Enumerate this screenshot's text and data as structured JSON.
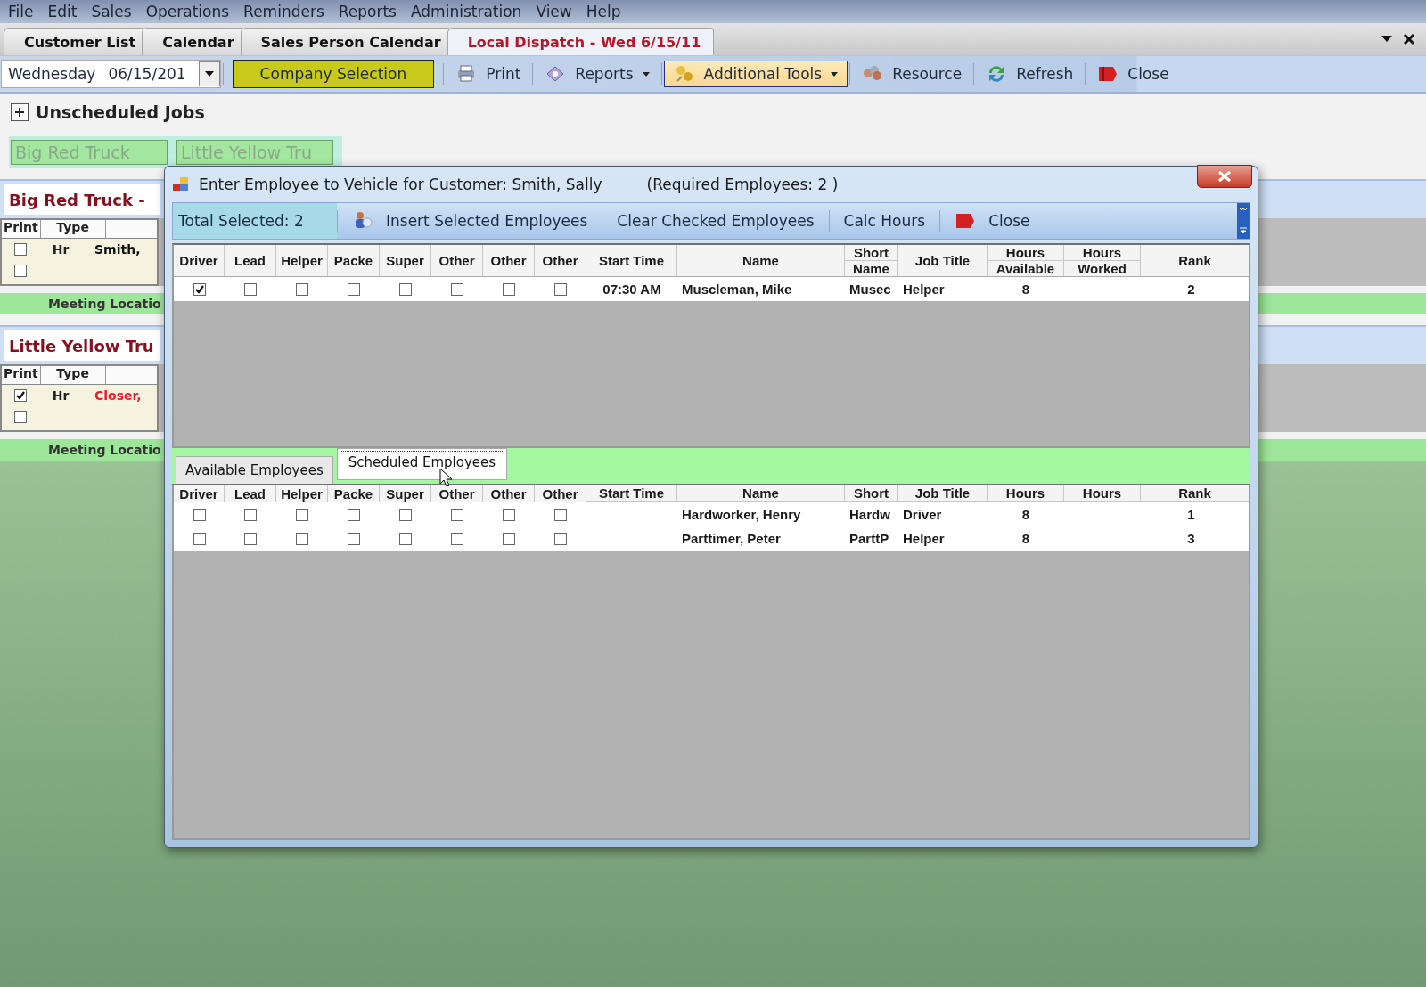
{
  "menu": [
    "File",
    "Edit",
    "Sales",
    "Operations",
    "Reminders",
    "Reports",
    "Administration",
    "View",
    "Help"
  ],
  "tabs": [
    {
      "label": "Customer List",
      "selected": false
    },
    {
      "label": "Calendar",
      "selected": false
    },
    {
      "label": "Sales Person Calendar",
      "selected": false
    },
    {
      "label": "Local Dispatch - Wed 6/15/11",
      "selected": true
    }
  ],
  "toolbar": [
    {
      "kind": "date",
      "label": "Wednesday",
      "value": "06/15/201"
    },
    {
      "kind": "accent",
      "label": "Company Selection"
    },
    {
      "kind": "button",
      "label": "Print",
      "hovered": false
    },
    {
      "kind": "menu",
      "label": "Reports",
      "hovered": false
    },
    {
      "kind": "menu",
      "label": "Additional Tools",
      "hovered": true
    },
    {
      "kind": "button",
      "label": "Resource",
      "hovered": false
    },
    {
      "kind": "button",
      "label": "Refresh",
      "hovered": false
    },
    {
      "kind": "button",
      "label": "Close",
      "hovered": false
    }
  ],
  "unscheduled": {
    "label": "Unscheduled Jobs",
    "expanded": false
  },
  "lanes": {
    "tabs": [
      "Big Red Truck",
      "Little Yellow Tru"
    ],
    "trucks": [
      {
        "name": "Big Red Truck -",
        "columns": [
          "Print",
          "Type"
        ],
        "rows": [
          {
            "checked": false,
            "type": "Hr",
            "customer": "Smith,",
            "color": "#111111"
          },
          {
            "checked": false
          }
        ],
        "footer": "Meeting Locatio"
      },
      {
        "name": "Little Yellow Tru",
        "columns": [
          "Print",
          "Type"
        ],
        "rows": [
          {
            "checked": true,
            "type": "Hr",
            "customer": "Closer,",
            "color": "#e8202a"
          },
          {
            "checked": false
          }
        ],
        "footer": "Meeting Locatio"
      }
    ]
  },
  "dialog": {
    "title": "Enter Employee to Vehicle for Customer: Smith, Sally",
    "subtitle": "(Required Employees: 2 )",
    "total": "Total Selected: 2",
    "actions": [
      "Insert Selected Employees",
      "Clear Checked Employees",
      "Calc Hours",
      "Close"
    ],
    "top_grid": {
      "filter_row": false,
      "columns": [
        {
          "kind": "role",
          "lines": [
            "Driver"
          ]
        },
        {
          "kind": "role",
          "lines": [
            "Lead"
          ]
        },
        {
          "kind": "role",
          "lines": [
            "Helper"
          ]
        },
        {
          "kind": "role",
          "lines": [
            "Packe"
          ]
        },
        {
          "kind": "role",
          "lines": [
            "Super"
          ]
        },
        {
          "kind": "role",
          "lines": [
            "Other"
          ]
        },
        {
          "kind": "role",
          "lines": [
            "Other"
          ]
        },
        {
          "kind": "role",
          "lines": [
            "Other"
          ]
        },
        {
          "kind": "field",
          "lines": [
            "Start Time"
          ]
        },
        {
          "kind": "field",
          "lines": [
            "Name"
          ]
        },
        {
          "kind": "field",
          "lines": [
            "Short",
            "Name"
          ]
        },
        {
          "kind": "field",
          "lines": [
            "Job Title"
          ]
        },
        {
          "kind": "field",
          "lines": [
            "Hours",
            "Available"
          ]
        },
        {
          "kind": "field",
          "lines": [
            "Hours",
            "Worked"
          ]
        },
        {
          "kind": "field",
          "lines": [
            "Rank"
          ]
        }
      ],
      "rows": [
        {
          "cells": [
            {
              "checked": true
            },
            {
              "checked": false
            },
            {
              "checked": false
            },
            {
              "checked": false
            },
            {
              "checked": false
            },
            {
              "checked": false
            },
            {
              "checked": false
            },
            {
              "checked": false
            },
            "07:30 AM",
            "Muscleman, Mike",
            "Musec",
            "Helper",
            "8",
            "",
            "2"
          ]
        }
      ]
    },
    "tabs": [
      {
        "label": "Available Employees",
        "selected": false
      },
      {
        "label": "Scheduled Employees",
        "selected": true
      }
    ],
    "bottom_grid": {
      "filter_row": true,
      "columns": [
        {
          "kind": "role",
          "lines": [
            "Driver"
          ]
        },
        {
          "kind": "role",
          "lines": [
            "Lead"
          ]
        },
        {
          "kind": "role",
          "lines": [
            "Helper"
          ]
        },
        {
          "kind": "role",
          "lines": [
            "Packe"
          ]
        },
        {
          "kind": "role",
          "lines": [
            "Super"
          ]
        },
        {
          "kind": "role",
          "lines": [
            "Other"
          ]
        },
        {
          "kind": "role",
          "lines": [
            "Other"
          ]
        },
        {
          "kind": "role",
          "lines": [
            "Other"
          ]
        },
        {
          "kind": "field",
          "lines": [
            "Start Time"
          ]
        },
        {
          "kind": "field",
          "lines": [
            "Name"
          ]
        },
        {
          "kind": "field",
          "lines": [
            "Short"
          ]
        },
        {
          "kind": "field",
          "lines": [
            "Job Title"
          ]
        },
        {
          "kind": "field",
          "lines": [
            "Hours"
          ]
        },
        {
          "kind": "field",
          "lines": [
            "Hours"
          ]
        },
        {
          "kind": "field",
          "lines": [
            "Rank"
          ]
        }
      ],
      "rows": [
        {
          "cells": [
            {
              "checked": false
            },
            {
              "checked": false
            },
            {
              "checked": false
            },
            {
              "checked": false
            },
            {
              "checked": false
            },
            {
              "checked": false
            },
            {
              "checked": false
            },
            {
              "checked": false
            },
            "",
            "Hardworker, Henry",
            "Hardw",
            "Driver",
            "8",
            "",
            "1"
          ]
        },
        {
          "cells": [
            {
              "checked": false
            },
            {
              "checked": false
            },
            {
              "checked": false
            },
            {
              "checked": false
            },
            {
              "checked": false
            },
            {
              "checked": false
            },
            {
              "checked": false
            },
            {
              "checked": false
            },
            "",
            "Parttimer, Peter",
            "ParttP",
            "Helper",
            "8",
            "",
            "3"
          ]
        }
      ]
    }
  }
}
